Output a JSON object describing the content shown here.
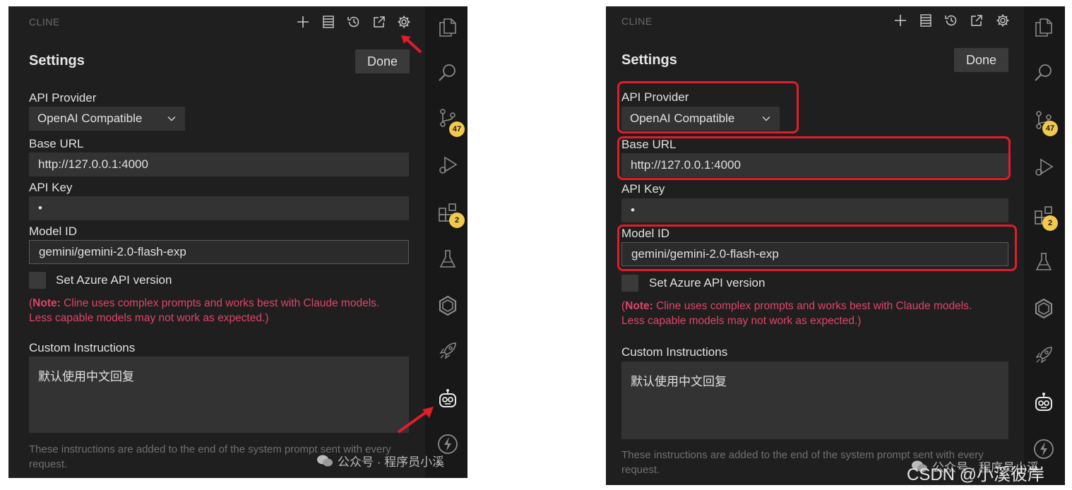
{
  "header": {
    "app_title": "CLINE",
    "icons": [
      "plus-icon",
      "history-list-icon",
      "history-icon",
      "open-external-icon",
      "gear-icon"
    ]
  },
  "settings": {
    "title": "Settings",
    "done_label": "Done",
    "api_provider_label": "API Provider",
    "api_provider_value": "OpenAI Compatible",
    "base_url_label": "Base URL",
    "base_url_value": "http://127.0.0.1:4000",
    "api_key_label": "API Key",
    "api_key_value": "•",
    "model_id_label": "Model ID",
    "model_id_value": "gemini/gemini-2.0-flash-exp",
    "azure_label": "Set Azure API version",
    "note_prefix": "(",
    "note_bold": "Note:",
    "note_text": " Cline uses complex prompts and works best with Claude models. Less capable models may not work as expected.)",
    "custom_instructions_label": "Custom Instructions",
    "custom_instructions_value": "默认使用中文回复",
    "hint": "These instructions are added to the end of the system prompt sent with every request."
  },
  "activity_bar": {
    "source_control_badge": "47",
    "extensions_badge": "2",
    "icons": [
      "explorer-icon",
      "search-icon",
      "source-control-icon",
      "run-debug-icon",
      "extensions-icon",
      "testing-icon",
      "openai-icon",
      "rocket-icon",
      "cline-robot-icon",
      "lightning-icon"
    ]
  },
  "watermarks": {
    "left": "公众号 · 程序员小溪",
    "right_wechat": "公众号 · 程序员小溪",
    "right_csdn": "CSDN @小溪彼岸"
  },
  "colors": {
    "panel_bg": "#1f1f1f",
    "activity_bg": "#181818",
    "input_bg": "#333333",
    "note_color": "#e04468",
    "badge_color": "#f2c94c",
    "highlight_red": "#e01d2a"
  }
}
